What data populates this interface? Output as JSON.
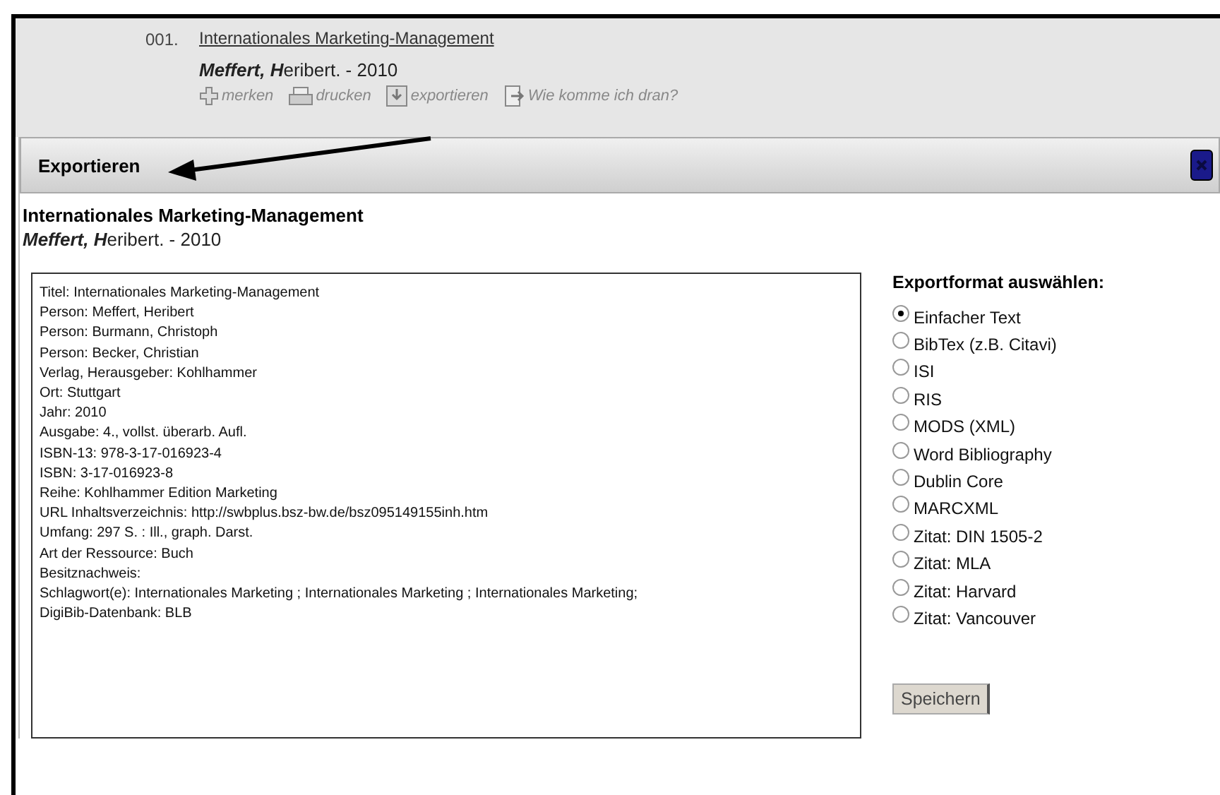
{
  "result": {
    "number": "001.",
    "title": "Internationales Marketing-Management",
    "author": "**Meffert, H**eribert. - 2010",
    "actions": [
      {
        "kind": "plus",
        "label": "merken"
      },
      {
        "kind": "print",
        "label": "drucken"
      },
      {
        "kind": "export",
        "label": "exportieren"
      },
      {
        "kind": "page",
        "label": "Wie komme ich dran?"
      }
    ]
  },
  "dialog": {
    "title": "Exportieren",
    "record_title": "Internationales Marketing-Management",
    "record_author": "**Meffert, H**eribert. - 2010",
    "export_lines": [
      "Titel: Internationales Marketing-Management",
      "Person: Meffert, Heribert",
      "Person: Burmann, Christoph",
      "Person: Becker, Christian",
      "Verlag, Herausgeber: Kohlhammer",
      "Ort: Stuttgart",
      "Jahr: 2010",
      "Ausgabe: 4., vollst. überarb. Aufl.",
      "ISBN-13: 978-3-17-016923-4",
      "ISBN: 3-17-016923-8",
      "Reihe: Kohlhammer Edition Marketing",
      "URL Inhaltsverzeichnis: http://swbplus.bsz-bw.de/bsz095149155inh.htm",
      "Umfang: 297 S. : Ill., graph. Darst.",
      "Art der Ressource: Buch",
      "Besitznachweis:",
      "Schlagwort(e): Internationales Marketing ; Internationales Marketing ; Internationales Marketing;",
      "DigiBib-Datenbank: BLB"
    ],
    "format_heading": "Exportformat auswählen:",
    "formats": [
      {
        "label": "Einfacher Text",
        "selected": true
      },
      {
        "label": "BibTex (z.B. Citavi)",
        "selected": false
      },
      {
        "label": "ISI",
        "selected": false
      },
      {
        "label": "RIS",
        "selected": false
      },
      {
        "label": "MODS (XML)",
        "selected": false
      },
      {
        "label": "Word Bibliography",
        "selected": false
      },
      {
        "label": "Dublin Core",
        "selected": false
      },
      {
        "label": "MARCXML",
        "selected": false
      },
      {
        "label": "Zitat: DIN 1505-2",
        "selected": false
      },
      {
        "label": "Zitat: MLA",
        "selected": false
      },
      {
        "label": "Zitat: Harvard",
        "selected": false
      },
      {
        "label": "Zitat: Vancouver",
        "selected": false
      }
    ],
    "save_button": "Speichern"
  }
}
